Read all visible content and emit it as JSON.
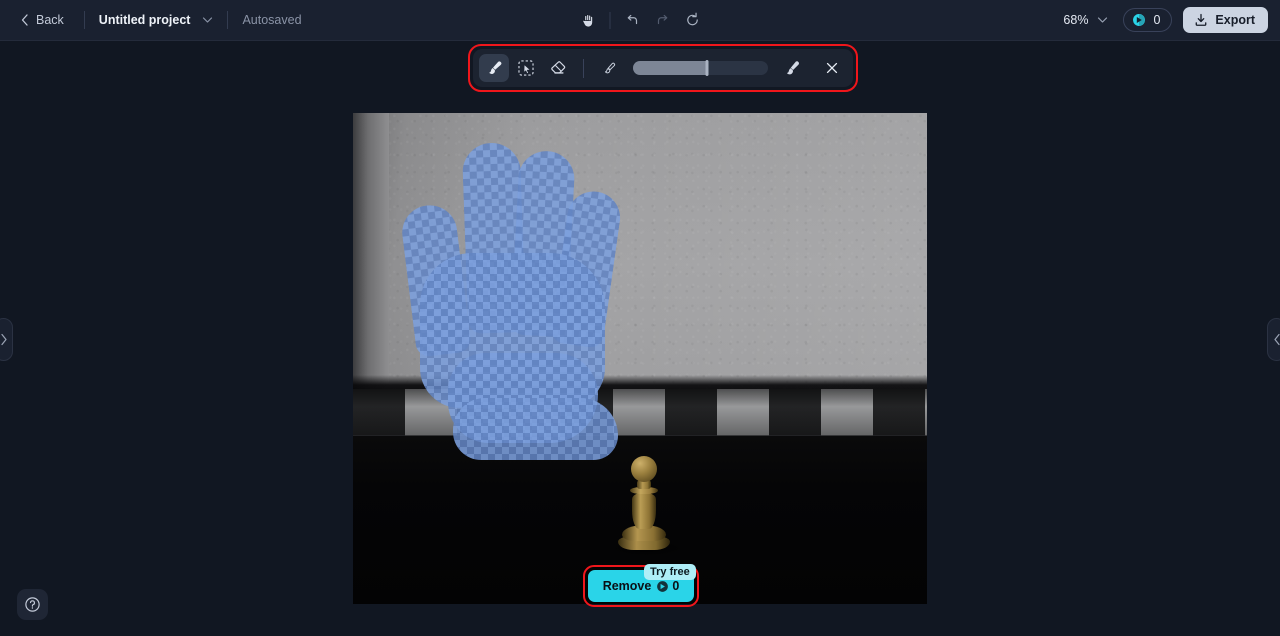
{
  "header": {
    "back_label": "Back",
    "project_title": "Untitled project",
    "autosaved_label": "Autosaved",
    "zoom_level": "68%",
    "credits_count": "0",
    "export_label": "Export",
    "center_tools": [
      {
        "name": "pan-hand-tool",
        "state": "enabled"
      },
      {
        "name": "undo-button",
        "state": "enabled"
      },
      {
        "name": "redo-button",
        "state": "disabled"
      },
      {
        "name": "reset-button",
        "state": "enabled"
      }
    ]
  },
  "toolbar": {
    "tools": [
      {
        "name": "brush-tool",
        "active": true
      },
      {
        "name": "select-object-tool",
        "active": false
      },
      {
        "name": "eraser-tool",
        "active": false
      }
    ],
    "brush_size_min_label": "small-brush-icon",
    "brush_size_max_label": "large-brush-icon",
    "brush_size_percent": 55,
    "close_label": "close-icon",
    "highlight_color": "#f0161b"
  },
  "canvas": {
    "left_panel_handle": "›",
    "right_panel_handle": "‹",
    "image": {
      "subject": "hand-shaped-selection-mask",
      "scene": "chess-pawn-on-checkered-floor",
      "mask_color": "#7da0dd"
    }
  },
  "remove": {
    "label": "Remove",
    "cost": "0",
    "try_free_label": "Try free",
    "accent_color": "#2ad4e8",
    "highlight_color": "#f0161b"
  },
  "help": {
    "label": "help-icon"
  }
}
